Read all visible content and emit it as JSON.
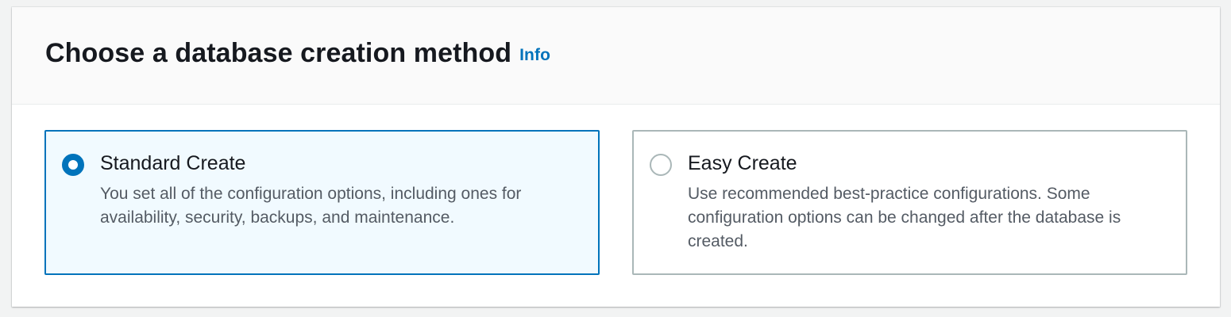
{
  "section": {
    "title": "Choose a database creation method",
    "info_link": "Info"
  },
  "options": [
    {
      "label": "Standard Create",
      "description": "You set all of the configuration options, including ones for availability, security, backups, and maintenance.",
      "selected": true
    },
    {
      "label": "Easy Create",
      "description": "Use recommended best-practice configurations. Some configuration options can be changed after the database is created.",
      "selected": false
    }
  ],
  "colors": {
    "accent": "#0073bb",
    "selected_background": "#f1faff",
    "border": "#aab7b8",
    "title_text": "#16191f",
    "description_text": "#545b64"
  }
}
